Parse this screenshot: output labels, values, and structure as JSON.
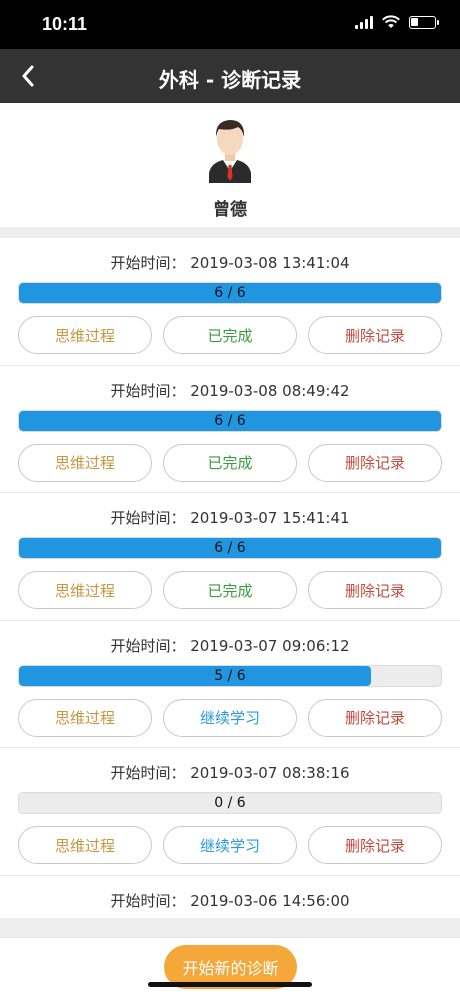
{
  "status_bar": {
    "time": "10:11"
  },
  "nav": {
    "title": "外科 - 诊断记录"
  },
  "profile": {
    "name": "曾德"
  },
  "colors": {
    "nav_bg": "#333333",
    "progress": "#2196e0",
    "primary_button": "#f4a83a"
  },
  "records": [
    {
      "start_time": "开始时间： 2019-03-08 13:41:04",
      "progress_text": "6 / 6",
      "progress_fraction": 1.0,
      "btn_think": "思维过程",
      "btn_status": "已完成",
      "status_type": "done",
      "btn_delete": "删除记录"
    },
    {
      "start_time": "开始时间： 2019-03-08 08:49:42",
      "progress_text": "6 / 6",
      "progress_fraction": 1.0,
      "btn_think": "思维过程",
      "btn_status": "已完成",
      "status_type": "done",
      "btn_delete": "删除记录"
    },
    {
      "start_time": "开始时间： 2019-03-07 15:41:41",
      "progress_text": "6 / 6",
      "progress_fraction": 1.0,
      "btn_think": "思维过程",
      "btn_status": "已完成",
      "status_type": "done",
      "btn_delete": "删除记录"
    },
    {
      "start_time": "开始时间： 2019-03-07 09:06:12",
      "progress_text": "5 / 6",
      "progress_fraction": 0.833,
      "btn_think": "思维过程",
      "btn_status": "继续学习",
      "status_type": "continue",
      "btn_delete": "删除记录"
    },
    {
      "start_time": "开始时间： 2019-03-07 08:38:16",
      "progress_text": "0 / 6",
      "progress_fraction": 0.0,
      "btn_think": "思维过程",
      "btn_status": "继续学习",
      "status_type": "continue",
      "btn_delete": "删除记录"
    },
    {
      "start_time": "开始时间： 2019-03-06 14:56:00"
    }
  ],
  "bottom": {
    "new_diagnosis_label": "开始新的诊断"
  }
}
